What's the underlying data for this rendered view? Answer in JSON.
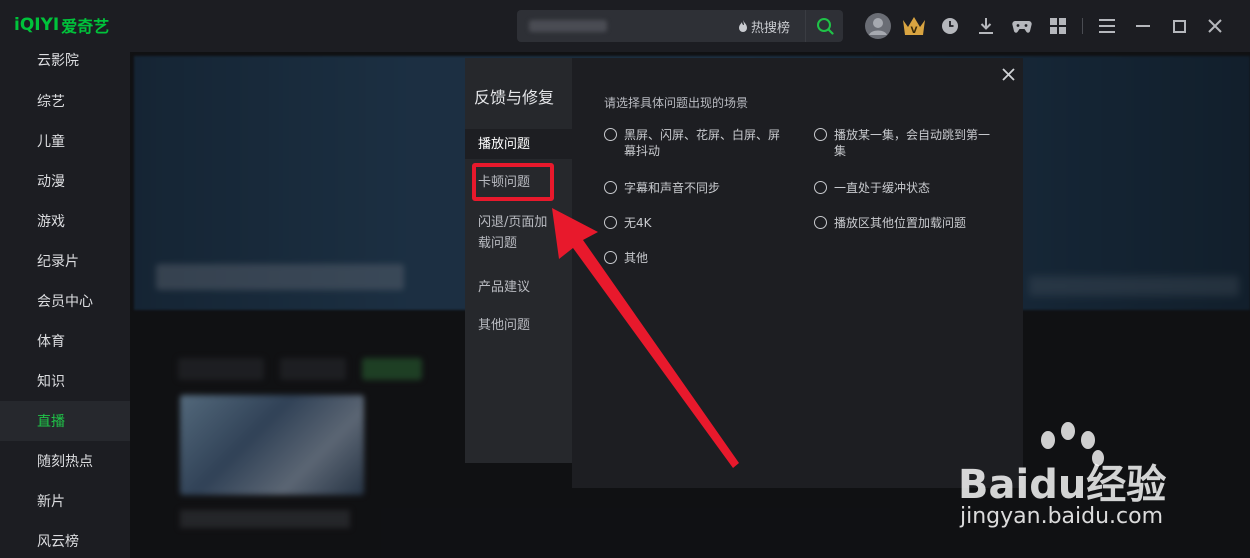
{
  "app": {
    "logo_latin": "iQIYI",
    "logo_cn": "爱奇艺",
    "search": {
      "hot_label": "热搜榜"
    }
  },
  "sidebar": {
    "items": [
      {
        "label": "云影院"
      },
      {
        "label": "综艺"
      },
      {
        "label": "儿童"
      },
      {
        "label": "动漫"
      },
      {
        "label": "游戏"
      },
      {
        "label": "纪录片"
      },
      {
        "label": "会员中心"
      },
      {
        "label": "体育"
      },
      {
        "label": "知识"
      },
      {
        "label": "直播",
        "active": true
      },
      {
        "label": "随刻热点"
      },
      {
        "label": "新片"
      },
      {
        "label": "风云榜"
      }
    ]
  },
  "dialog": {
    "title": "反馈与修复",
    "nav": [
      {
        "label": "播放问题",
        "selected": true
      },
      {
        "label": "卡顿问题"
      },
      {
        "label": "闪退/页面加载问题"
      },
      {
        "label": "产品建议"
      },
      {
        "label": "其他问题"
      }
    ],
    "prompt": "请选择具体问题出现的场景",
    "options": [
      {
        "label": "黑屏、闪屏、花屏、白屏、屏幕抖动"
      },
      {
        "label": "播放某一集，会自动跳到第一集"
      },
      {
        "label": "字幕和声音不同步"
      },
      {
        "label": "一直处于缓冲状态"
      },
      {
        "label": "无4K"
      },
      {
        "label": "播放区其他位置加载问题"
      },
      {
        "label": "其他"
      }
    ]
  },
  "watermark": {
    "brand": "Baidu经验",
    "url": "jingyan.baidu.com"
  },
  "colors": {
    "accent_green": "#1fc348",
    "annotation_red": "#e8192c",
    "vip_gold": "#d9a441"
  }
}
